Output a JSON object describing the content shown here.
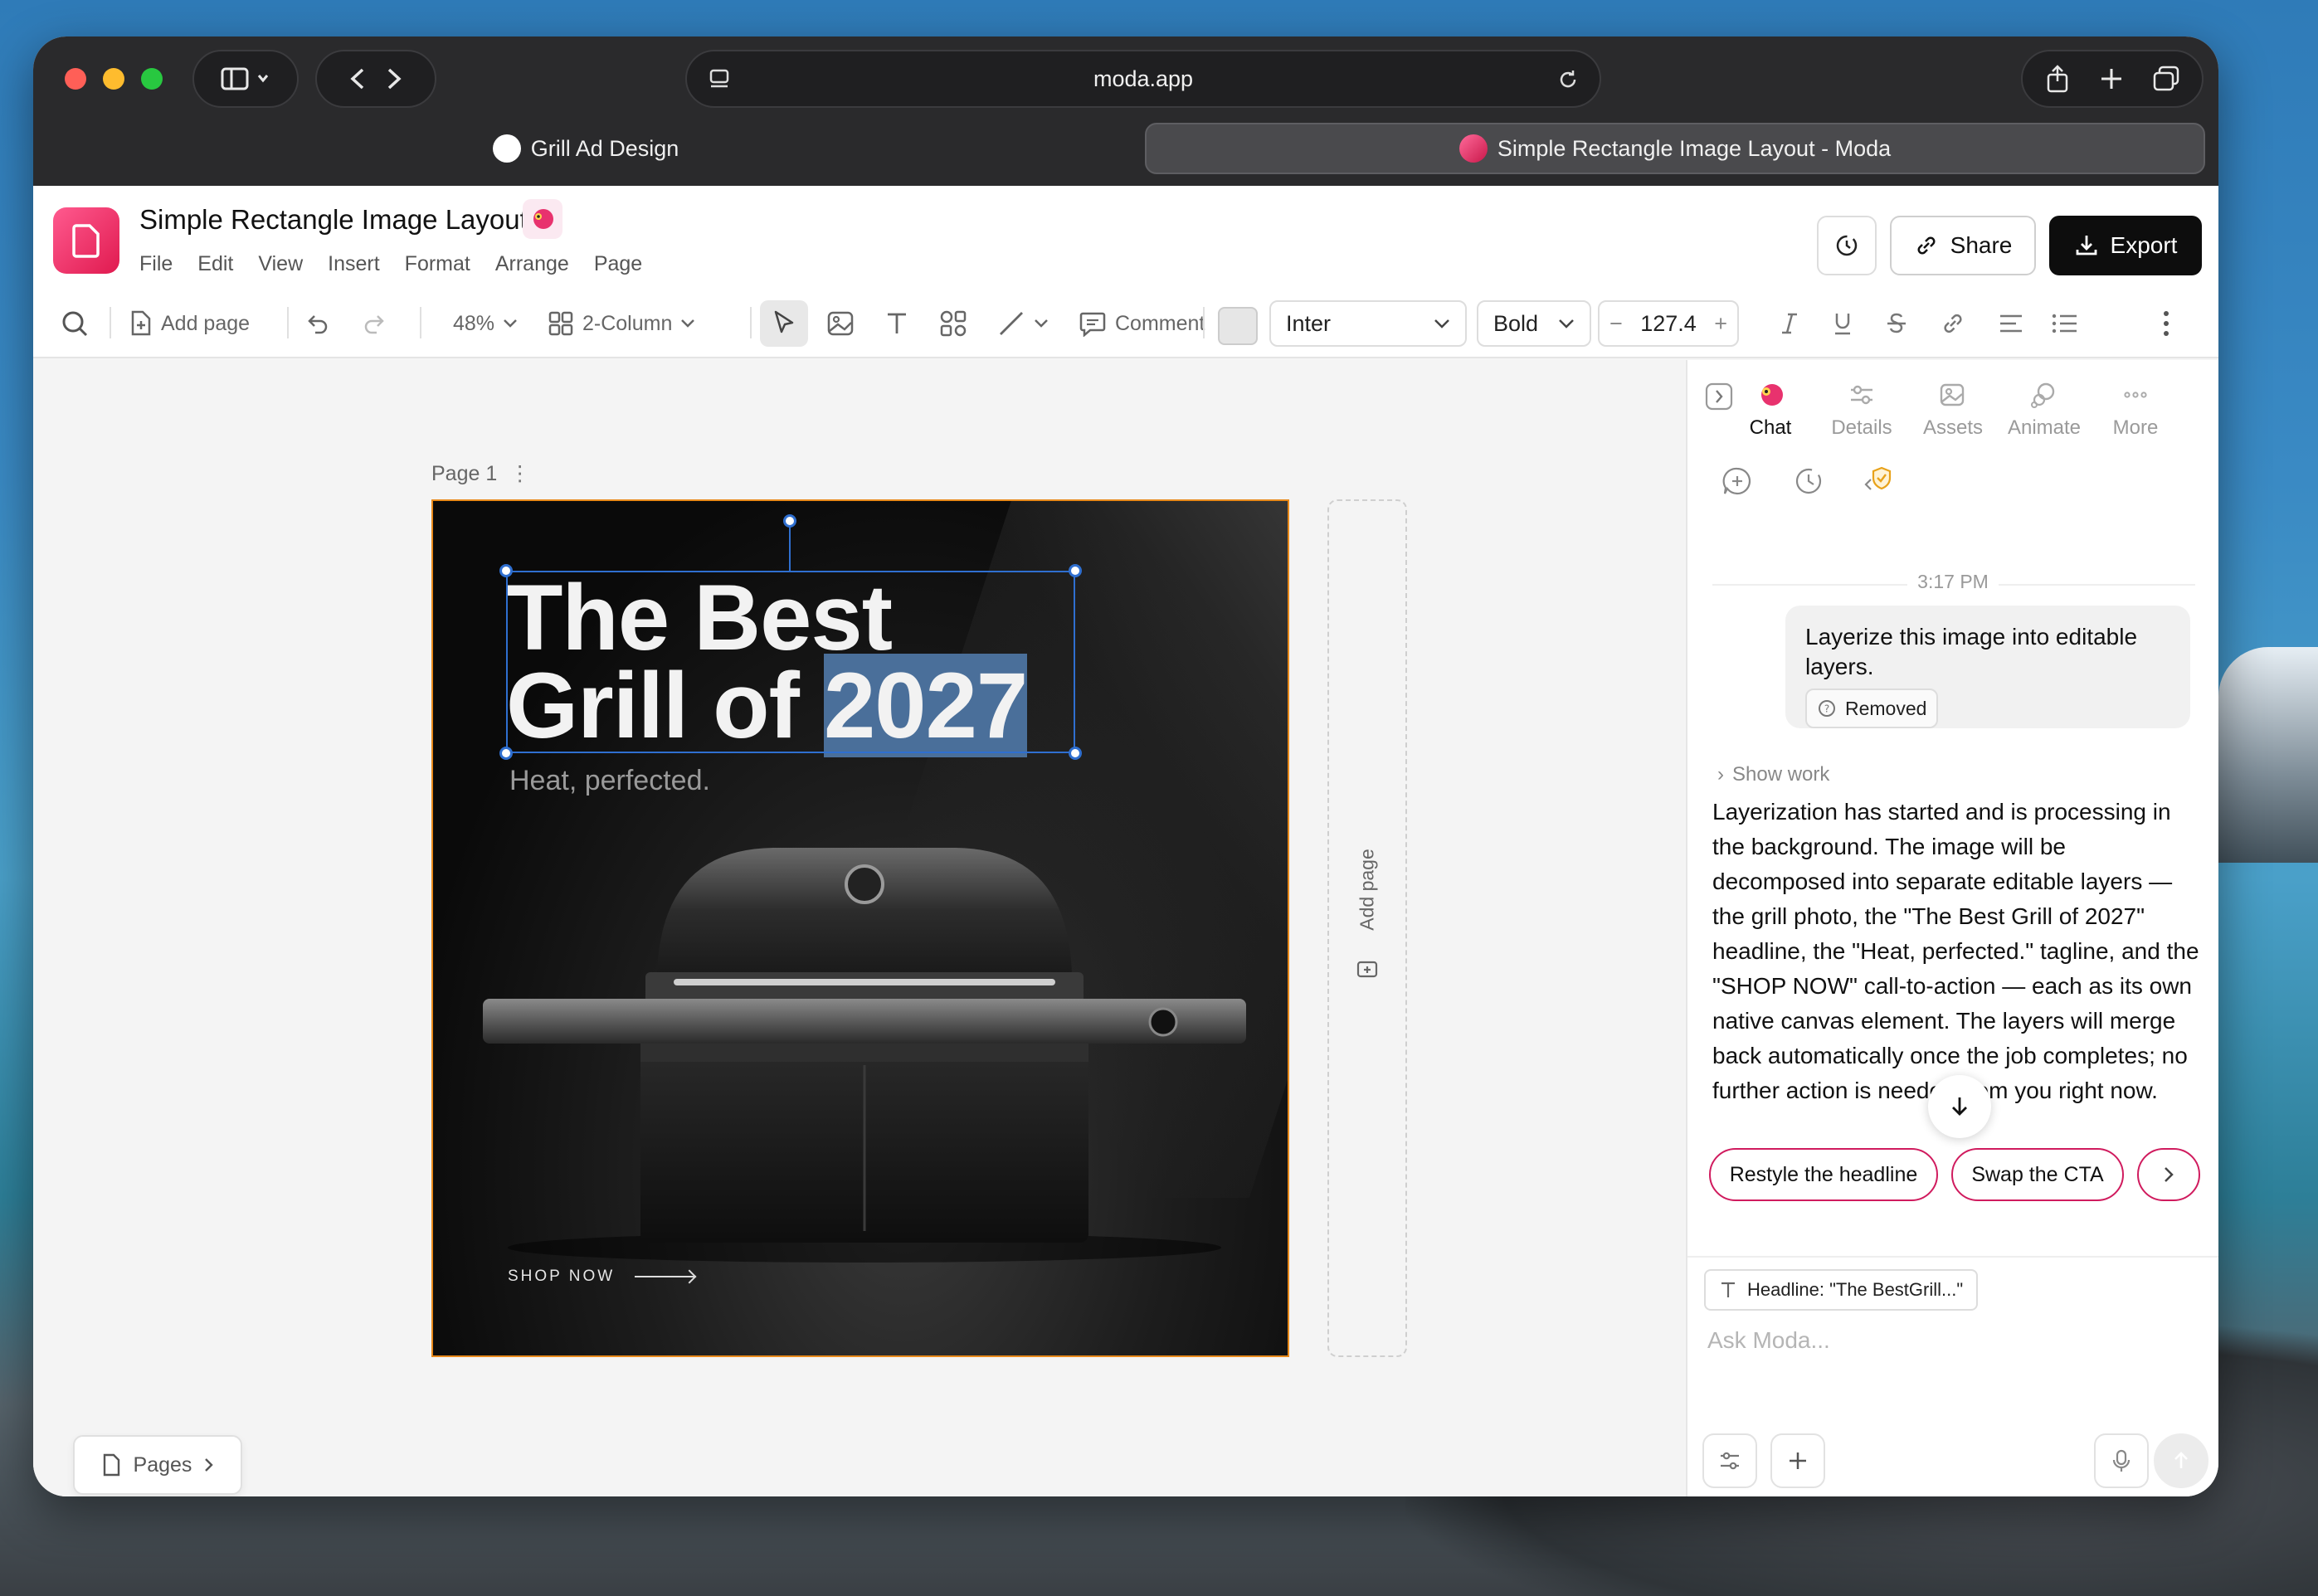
{
  "browser": {
    "url": "moda.app",
    "tabs": [
      {
        "label": "Grill Ad Design"
      },
      {
        "label": "Simple Rectangle Image Layout - Moda"
      }
    ]
  },
  "app": {
    "doc_title": "Simple Rectangle Image Layout",
    "menu": [
      "File",
      "Edit",
      "View",
      "Insert",
      "Format",
      "Arrange",
      "Page"
    ],
    "share_label": "Share",
    "export_label": "Export"
  },
  "toolbar": {
    "add_page": "Add page",
    "zoom": "48%",
    "layout": "2-Column",
    "comment": "Comment",
    "font": "Inter",
    "weight": "Bold",
    "font_size": "127.4",
    "fill_color": "#e6e6e6"
  },
  "canvas": {
    "page_label": "Page 1",
    "headline_line1": "The Best",
    "headline_line2_a": "Grill of ",
    "headline_line2_b": "2027",
    "tagline": "Heat, perfected.",
    "cta": "SHOP NOW",
    "add_page_vertical": "Add page",
    "pages_button": "Pages"
  },
  "panel": {
    "tabs": [
      "Chat",
      "Details",
      "Assets",
      "Animate",
      "More"
    ],
    "active_tab": "Chat",
    "timestamp": "3:17 PM",
    "user_message": "Layerize this image into editable layers.",
    "removed_chip": "Removed",
    "show_work": "Show work",
    "assistant_reply": "Layerization has started and is processing in the background. The image will be decomposed into separate editable layers — the grill photo, the \"The Best Grill of 2027\" headline, the \"Heat, perfected.\" tagline, and the \"SHOP NOW\" call-to-action — each as its own native canvas element. The layers will merge back automatically once the job completes; no further action is needed from you right now.",
    "suggestions": [
      "Restyle the headline",
      "Swap the CTA"
    ],
    "context_chip": "Headline: \"The BestGrill...\"",
    "ask_placeholder": "Ask Moda..."
  },
  "colors": {
    "brand": "#e01a4f",
    "selection": "#2f6fd0",
    "artboard_border": "#e8891a"
  }
}
